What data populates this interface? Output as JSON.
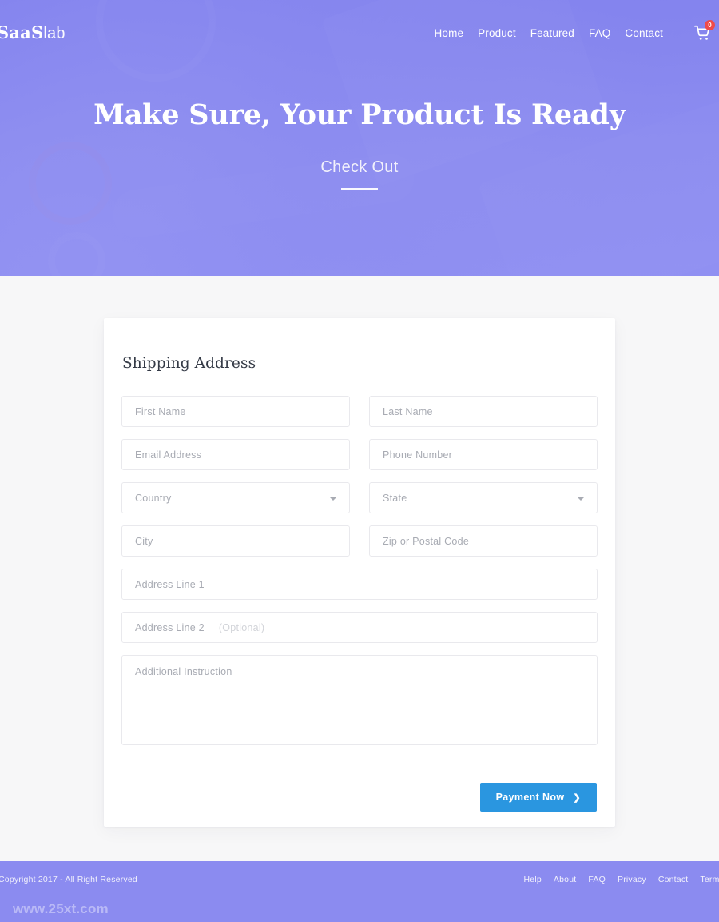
{
  "colors": {
    "hero_purple": "#8b8bf0",
    "page_bg": "#f7f7f8",
    "card_bg": "#ffffff",
    "button_blue": "#2a96e0",
    "badge_red": "#ef4b4b",
    "placeholder_gray": "#a8abb3",
    "border_gray": "#e9e9ed"
  },
  "navbar": {
    "brand_strong": "SaaS",
    "brand_light": "lab",
    "links": [
      {
        "label": "Home"
      },
      {
        "label": "Product"
      },
      {
        "label": "Featured"
      },
      {
        "label": "FAQ"
      },
      {
        "label": "Contact"
      }
    ],
    "cart": {
      "icon": "shopping-cart-icon",
      "badge_count": "0"
    }
  },
  "hero": {
    "title": "Make Sure, Your Product Is Ready",
    "subtitle": "Check Out"
  },
  "card": {
    "title": "Shipping Address",
    "fields": {
      "first_name": "First Name",
      "last_name": "Last Name",
      "email": "Email Address",
      "phone": "Phone Number",
      "country": "Country",
      "state": "State",
      "city": "City",
      "zip": "Zip or Postal Code",
      "address1": "Address Line 1",
      "address2": "Address Line 2",
      "address2_optional": "(Optional)",
      "additional": "Additional Instruction"
    },
    "submit": {
      "label": "Payment Now",
      "chevron": "❯"
    }
  },
  "footer": {
    "copyright": "Copyright 2017 - All Right Reserved",
    "links": [
      {
        "label": "Help"
      },
      {
        "label": "About"
      },
      {
        "label": "FAQ"
      },
      {
        "label": "Privacy"
      },
      {
        "label": "Contact"
      },
      {
        "label": "Terms"
      }
    ],
    "watermark": "www.25xt.com"
  }
}
